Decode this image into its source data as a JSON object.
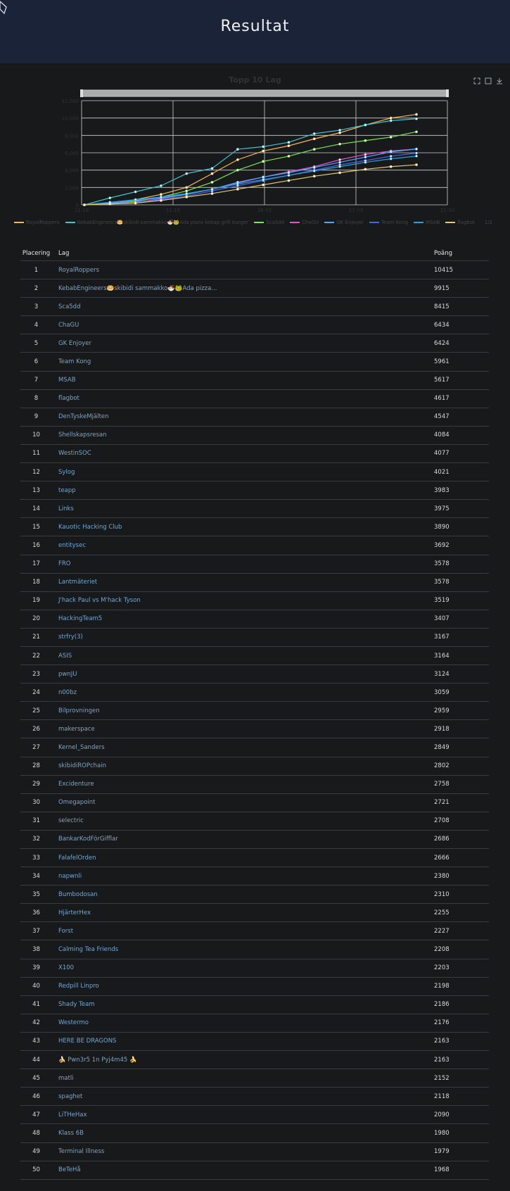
{
  "header": {
    "title": "Resultat"
  },
  "chart": {
    "title": "Topp 10 Lag",
    "y_ticks": [
      "12,000",
      "10,000",
      "8,000",
      "6,000",
      "4,000",
      "2,000",
      "0"
    ],
    "x_ticks": [
      "11-16",
      "11-16",
      "16-02",
      "21-09",
      "21-10"
    ],
    "legend_page": "1/2"
  },
  "chart_data": {
    "type": "line",
    "title": "Topp 10 Lag",
    "ylim": [
      0,
      12000
    ],
    "grid": true,
    "legend_placement": "bottom",
    "series": [
      {
        "name": "RoyalRoppers",
        "values": [
          0,
          200,
          600,
          1200,
          2000,
          3600,
          5200,
          6200,
          6800,
          7600,
          8300,
          9200,
          10000,
          10415
        ]
      },
      {
        "name": "KebabEngineers",
        "values": [
          0,
          800,
          1500,
          2200,
          3600,
          4200,
          6400,
          6700,
          7200,
          8200,
          8600,
          9200,
          9700,
          9915
        ]
      },
      {
        "name": "Sca5dd",
        "values": [
          0,
          100,
          400,
          900,
          1600,
          2600,
          4000,
          5000,
          5600,
          6400,
          7000,
          7400,
          7800,
          8415
        ]
      },
      {
        "name": "ChaGU",
        "values": [
          0,
          100,
          300,
          700,
          1200,
          1800,
          2500,
          3200,
          3800,
          4400,
          5200,
          5800,
          6200,
          6434
        ]
      },
      {
        "name": "GK Enjoyer",
        "values": [
          0,
          200,
          500,
          800,
          1200,
          1800,
          2600,
          3200,
          3700,
          4300,
          4900,
          5500,
          6100,
          6424
        ]
      },
      {
        "name": "Team Kong",
        "values": [
          0,
          100,
          300,
          600,
          1000,
          1600,
          2200,
          2800,
          3400,
          4000,
          4600,
          5100,
          5600,
          5961
        ]
      },
      {
        "name": "MSAB",
        "values": [
          0,
          300,
          600,
          900,
          1300,
          1800,
          2400,
          2900,
          3400,
          3900,
          4400,
          4900,
          5300,
          5617
        ]
      },
      {
        "name": "flagbot",
        "values": [
          0,
          100,
          200,
          500,
          900,
          1300,
          1800,
          2300,
          2800,
          3300,
          3700,
          4100,
          4400,
          4617
        ]
      }
    ],
    "legend": [
      "RoyalRoppers",
      "KebabEngineers🥯skibidi sammakko🍜🐸Ada pizza kebap grill burger",
      "Sca5dd",
      "ChaGU",
      "GK Enjoyer",
      "Team Kong",
      "MSAB",
      "flagbot"
    ]
  },
  "table": {
    "headers": {
      "pos": "Placering",
      "team": "Lag",
      "pts": "Poäng"
    },
    "rows": [
      {
        "pos": "1",
        "team": "RoyalRoppers",
        "pts": "10415"
      },
      {
        "pos": "2",
        "team": "KebabEngineers🥯skibidi sammakko🍜🐸Ada pizza...",
        "pts": "9915"
      },
      {
        "pos": "3",
        "team": "Sca5dd",
        "pts": "8415"
      },
      {
        "pos": "4",
        "team": "ChaGU",
        "pts": "6434"
      },
      {
        "pos": "5",
        "team": "GK Enjoyer",
        "pts": "6424"
      },
      {
        "pos": "6",
        "team": "Team Kong",
        "pts": "5961"
      },
      {
        "pos": "7",
        "team": "MSAB",
        "pts": "5617"
      },
      {
        "pos": "8",
        "team": "flagbot",
        "pts": "4617"
      },
      {
        "pos": "9",
        "team": "DenTyskeMjälten",
        "pts": "4547"
      },
      {
        "pos": "10",
        "team": "Shellskapsresan",
        "pts": "4084"
      },
      {
        "pos": "11",
        "team": "WestinSOC",
        "pts": "4077"
      },
      {
        "pos": "12",
        "team": "Sylog",
        "pts": "4021"
      },
      {
        "pos": "13",
        "team": "teapp",
        "pts": "3983"
      },
      {
        "pos": "14",
        "team": "Links",
        "pts": "3975"
      },
      {
        "pos": "15",
        "team": "Kauotic Hacking Club",
        "pts": "3890"
      },
      {
        "pos": "16",
        "team": "entitysec",
        "pts": "3692"
      },
      {
        "pos": "17",
        "team": "FRO",
        "pts": "3578"
      },
      {
        "pos": "18",
        "team": "Lantmäteriet",
        "pts": "3578"
      },
      {
        "pos": "19",
        "team": "J'hack Paul vs M'hack Tyson",
        "pts": "3519"
      },
      {
        "pos": "20",
        "team": "HackingTeam5",
        "pts": "3407"
      },
      {
        "pos": "21",
        "team": "strfry(3)",
        "pts": "3167"
      },
      {
        "pos": "22",
        "team": "ASIS",
        "pts": "3164"
      },
      {
        "pos": "23",
        "team": "pwnJU",
        "pts": "3124"
      },
      {
        "pos": "24",
        "team": "n00bz",
        "pts": "3059"
      },
      {
        "pos": "25",
        "team": "Bilprovningen",
        "pts": "2959"
      },
      {
        "pos": "26",
        "team": "makerspace",
        "pts": "2918"
      },
      {
        "pos": "27",
        "team": "Kernel_Sanders",
        "pts": "2849"
      },
      {
        "pos": "28",
        "team": "skibidiROPchain",
        "pts": "2802"
      },
      {
        "pos": "29",
        "team": "Excidenture",
        "pts": "2758"
      },
      {
        "pos": "30",
        "team": "Omegapoint",
        "pts": "2721"
      },
      {
        "pos": "31",
        "team": "selectric",
        "pts": "2708"
      },
      {
        "pos": "32",
        "team": "BankarKodFörGifflar",
        "pts": "2686"
      },
      {
        "pos": "33",
        "team": "FalafelOrden",
        "pts": "2666"
      },
      {
        "pos": "34",
        "team": "napwnli",
        "pts": "2380"
      },
      {
        "pos": "35",
        "team": "Bumbodosan",
        "pts": "2310"
      },
      {
        "pos": "36",
        "team": "HjärterHex",
        "pts": "2255"
      },
      {
        "pos": "37",
        "team": "Forst",
        "pts": "2227"
      },
      {
        "pos": "38",
        "team": "Calming Tea Friends",
        "pts": "2208"
      },
      {
        "pos": "39",
        "team": "X100",
        "pts": "2203"
      },
      {
        "pos": "40",
        "team": "Redpill Linpro",
        "pts": "2198"
      },
      {
        "pos": "41",
        "team": "Shady Team",
        "pts": "2186"
      },
      {
        "pos": "42",
        "team": "Westermo",
        "pts": "2176"
      },
      {
        "pos": "43",
        "team": "HERE BE DRAGONS",
        "pts": "2163"
      },
      {
        "pos": "44",
        "team": "🍌 Pwn3r5 1n Pyj4m45 🍌",
        "pts": "2163"
      },
      {
        "pos": "45",
        "team": "matli",
        "pts": "2152"
      },
      {
        "pos": "46",
        "team": "spaghet",
        "pts": "2118"
      },
      {
        "pos": "47",
        "team": "LiTHeHax",
        "pts": "2090"
      },
      {
        "pos": "48",
        "team": "Klass 6B",
        "pts": "1980"
      },
      {
        "pos": "49",
        "team": "Terminal Illness",
        "pts": "1979"
      },
      {
        "pos": "50",
        "team": "BeTeHå",
        "pts": "1968"
      }
    ]
  },
  "colors": [
    "#f7b84b",
    "#3ec6d6",
    "#7ae84d",
    "#e54fd0",
    "#4aa8ff",
    "#4666e8",
    "#22a3e0",
    "#e8c86a"
  ]
}
